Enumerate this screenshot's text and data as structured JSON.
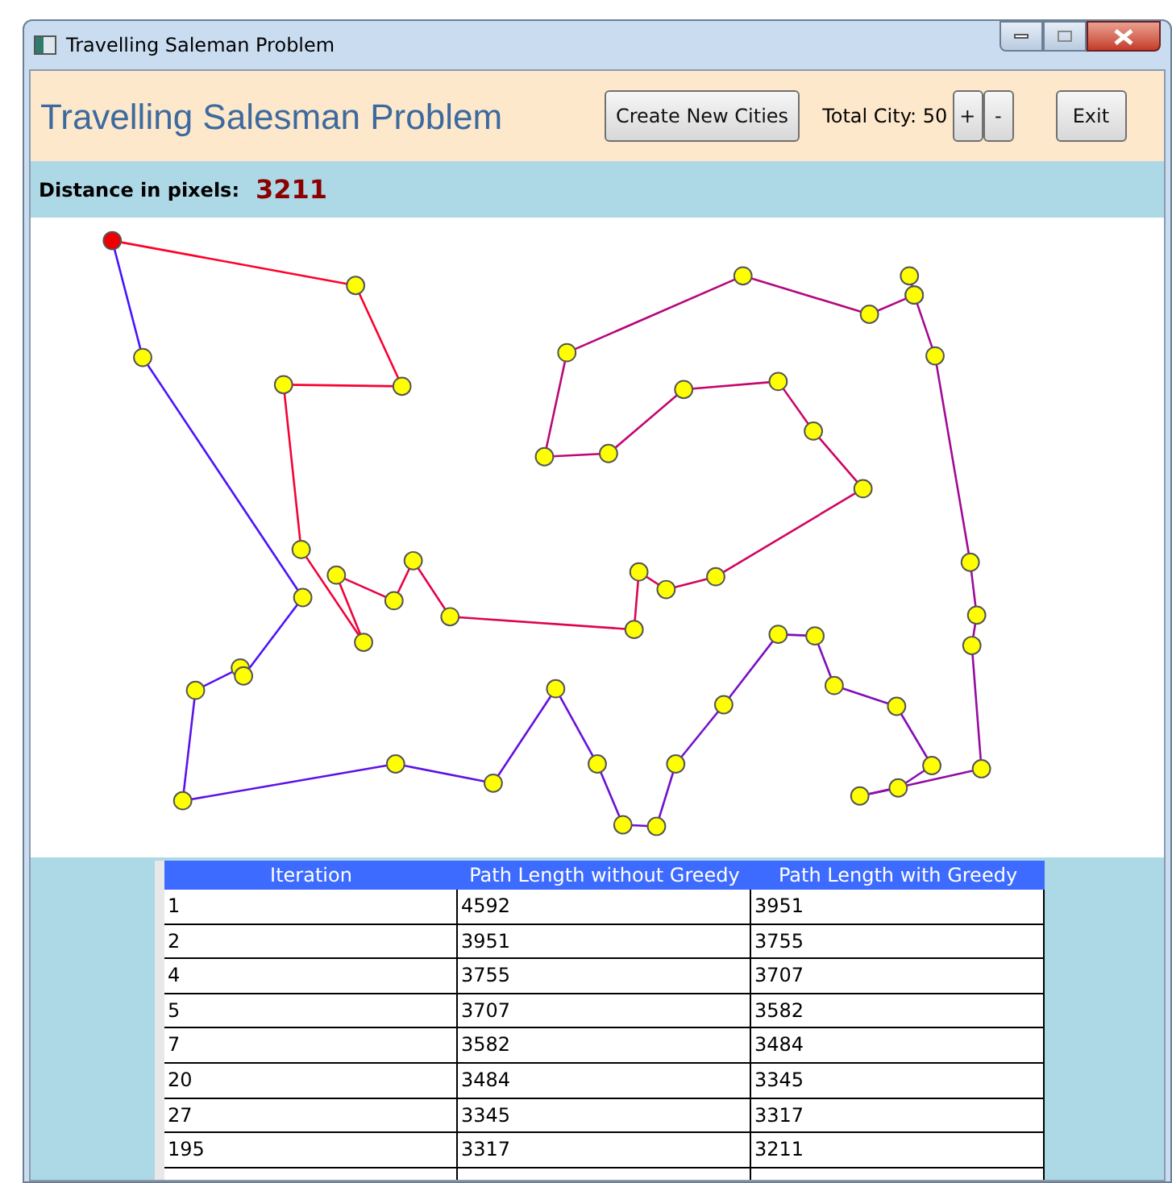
{
  "window": {
    "title": "Travelling Saleman Problem"
  },
  "header": {
    "title": "Travelling Salesman Problem",
    "create_button": "Create New Cities",
    "total_label": "Total City: 50",
    "plus_button": "+",
    "minus_button": "-",
    "exit_button": "Exit"
  },
  "distance": {
    "label": "Distance in pixels:",
    "value": "3211"
  },
  "table": {
    "columns": [
      "Iteration",
      "Path Length without Greedy",
      "Path Length with Greedy"
    ],
    "rows": [
      [
        "1",
        "4592",
        "3951"
      ],
      [
        "2",
        "3951",
        "3755"
      ],
      [
        "4",
        "3755",
        "3707"
      ],
      [
        "5",
        "3707",
        "3582"
      ],
      [
        "7",
        "3582",
        "3484"
      ],
      [
        "20",
        "3484",
        "3345"
      ],
      [
        "27",
        "3345",
        "3317"
      ],
      [
        "195",
        "3317",
        "3211"
      ]
    ]
  }
}
